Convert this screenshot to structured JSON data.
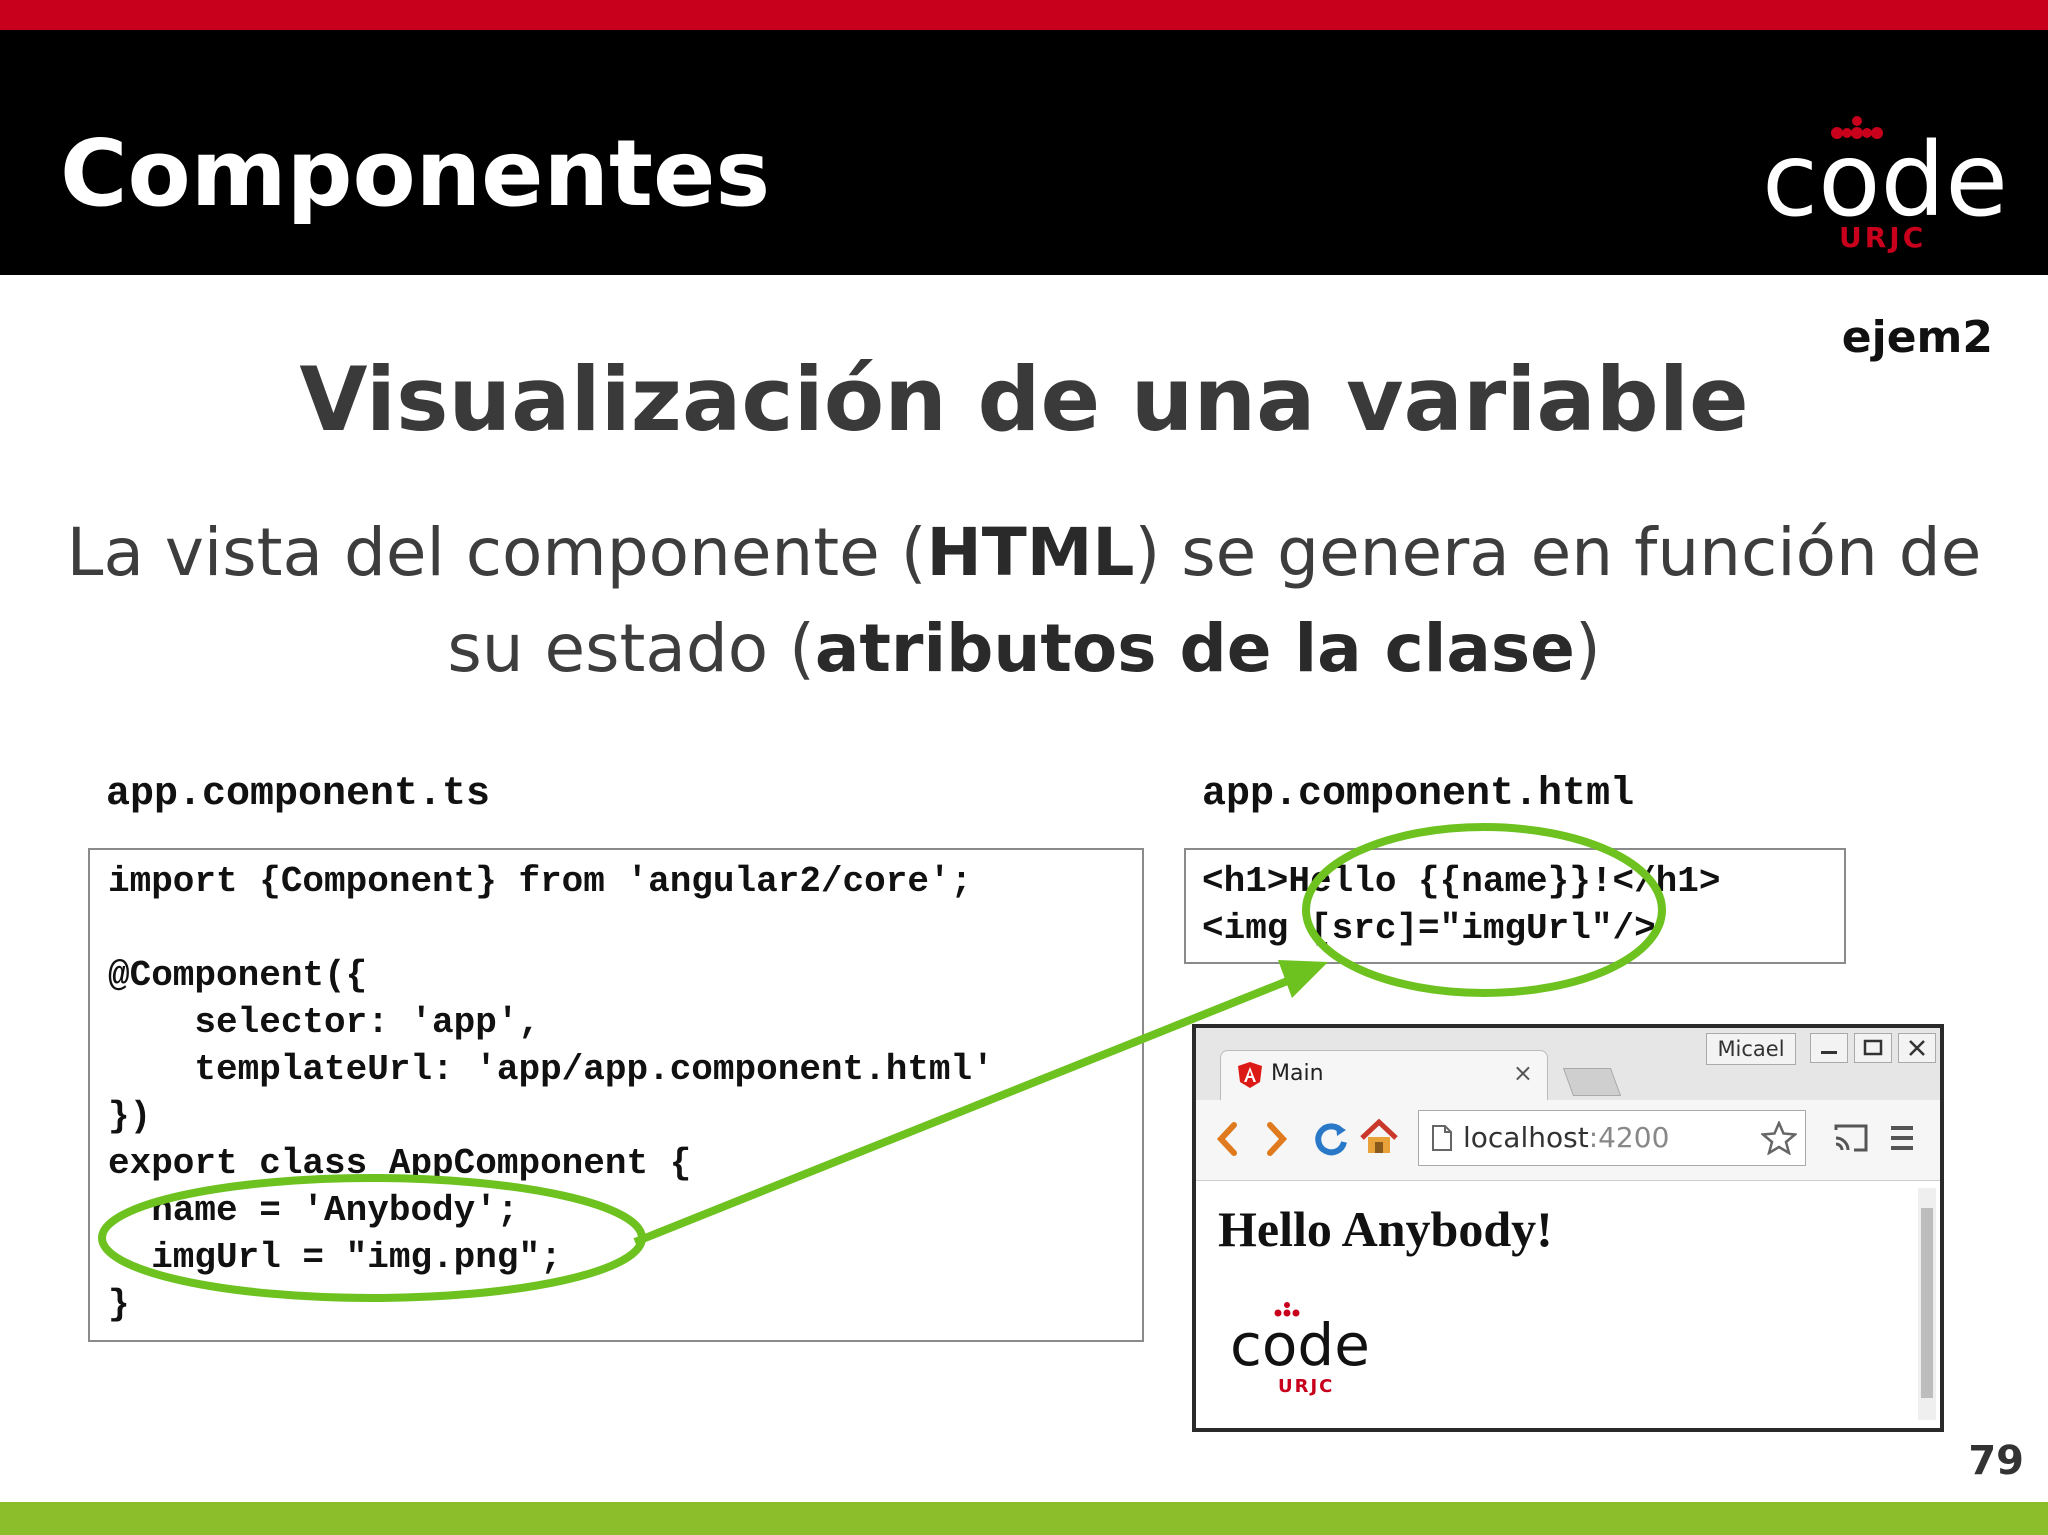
{
  "header": {
    "title": "Componentes",
    "logo_word": "code",
    "logo_sub": "URJC"
  },
  "example_tag": "ejem2",
  "slide": {
    "title": "Visualización de una variable",
    "lead_part1": "La vista del componente (",
    "lead_bold1": "HTML",
    "lead_part2": ") se genera en función de su estado (",
    "lead_bold2": "atributos de la clase",
    "lead_part3": ")"
  },
  "ts_file": {
    "label": "app.component.ts",
    "lines": [
      "import {Component} from 'angular2/core';",
      "",
      "@Component({",
      "    selector: 'app',",
      "    templateUrl: 'app/app.component.html'",
      "})",
      "export class AppComponent {",
      "  name = 'Anybody';",
      "  imgUrl = \"img.png\";",
      "}"
    ]
  },
  "html_file": {
    "label": "app.component.html",
    "lines": [
      "<h1>Hello {{name}}!</h1>",
      "<img [src]=\"imgUrl\"/>"
    ]
  },
  "browser": {
    "user": "Micael",
    "tab_title": "Main",
    "url_host": "localhost",
    "url_port": ":4200",
    "content_heading": "Hello Anybody!",
    "logo_word": "code",
    "logo_sub": "URJC"
  },
  "page_number": "79",
  "colors": {
    "red": "#c8001b",
    "green": "#8cbd2a",
    "highlight": "#6dc21f",
    "header_bg": "#000000"
  }
}
